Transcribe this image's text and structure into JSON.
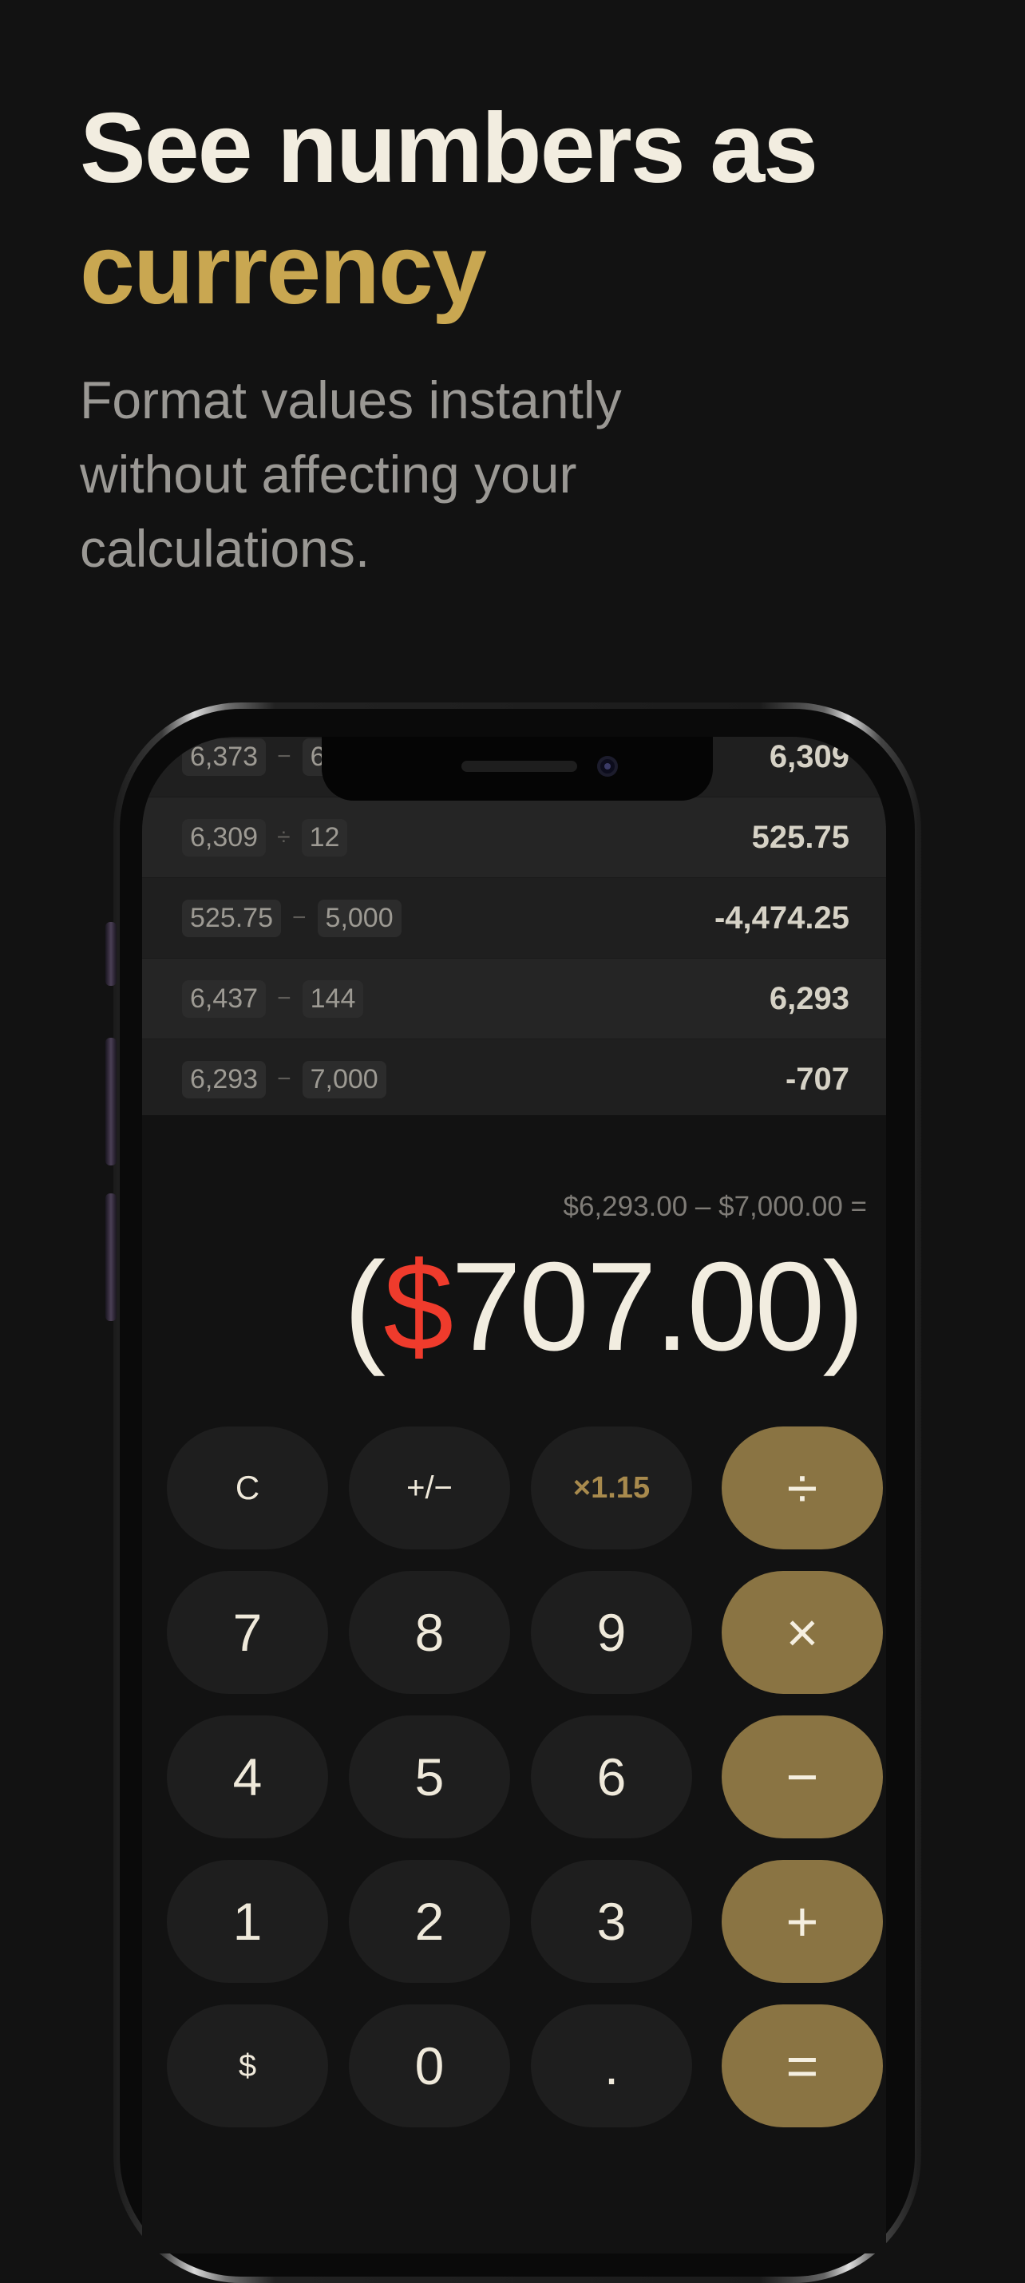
{
  "headline": {
    "line1": "See numbers as",
    "line2": "currency",
    "subtitle": "Format values instantly without affecting your calculations."
  },
  "colors": {
    "background": "#121212",
    "accent_gold": "#c9a751",
    "operator_key": "#8a7443",
    "negative_red": "#ef3b2c"
  },
  "history": [
    {
      "a": "6,373",
      "op": "−",
      "b": "6",
      "result": "6,309"
    },
    {
      "a": "6,309",
      "op": "÷",
      "b": "12",
      "result": "525.75"
    },
    {
      "a": "525.75",
      "op": "−",
      "b": "5,000",
      "result": "-4,474.25"
    },
    {
      "a": "6,437",
      "op": "−",
      "b": "144",
      "result": "6,293"
    },
    {
      "a": "6,293",
      "op": "−",
      "b": "7,000",
      "result": "-707"
    }
  ],
  "display": {
    "expression": "$6,293.00 – $7,000.00 =",
    "open_paren": "(",
    "currency_symbol": "$",
    "amount": "707.00",
    "close_paren": ")"
  },
  "keypad": {
    "clear": "C",
    "sign": "+/−",
    "multiplier": "×1.15",
    "divide": "÷",
    "seven": "7",
    "eight": "8",
    "nine": "9",
    "multiply": "×",
    "four": "4",
    "five": "5",
    "six": "6",
    "minus": "−",
    "one": "1",
    "two": "2",
    "three": "3",
    "plus": "+",
    "currency": "$",
    "zero": "0",
    "decimal": ".",
    "equals": "="
  }
}
